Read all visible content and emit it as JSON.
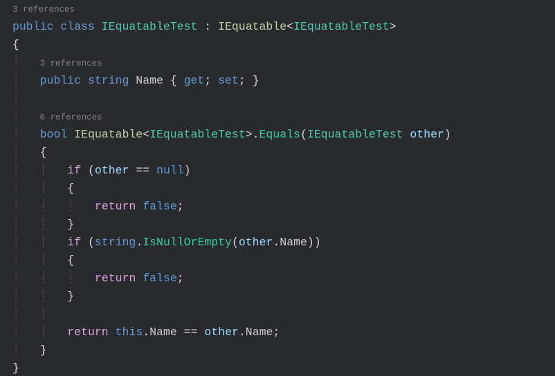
{
  "codelens": {
    "class_refs": "3 references",
    "name_refs": "3 references",
    "equals_refs": "0 references"
  },
  "tok": {
    "public": "public",
    "class": "class",
    "string_kw": "string",
    "bool": "bool",
    "return": "return",
    "if": "if",
    "this": "this",
    "null": "null",
    "false": "false",
    "get": "get",
    "set": "set",
    "IEquatableTest": "IEquatableTest",
    "IEquatable": "IEquatable",
    "Name": "Name",
    "Equals": "Equals",
    "IsNullOrEmpty": "IsNullOrEmpty",
    "other": "other"
  },
  "sym": {
    "colon": ":",
    "lt": "<",
    "gt": ">",
    "obrace": "{",
    "cbrace": "}",
    "oparen": "(",
    "cparen": ")",
    "semi": ";",
    "dot": ".",
    "eqeq": "==",
    "guide": "┊",
    "guide2": "┊   ",
    "guide3": "┊   ┊   ",
    "guide4": "┊   ┊   ┊   ",
    "sp": " ",
    "sp4": "    "
  }
}
